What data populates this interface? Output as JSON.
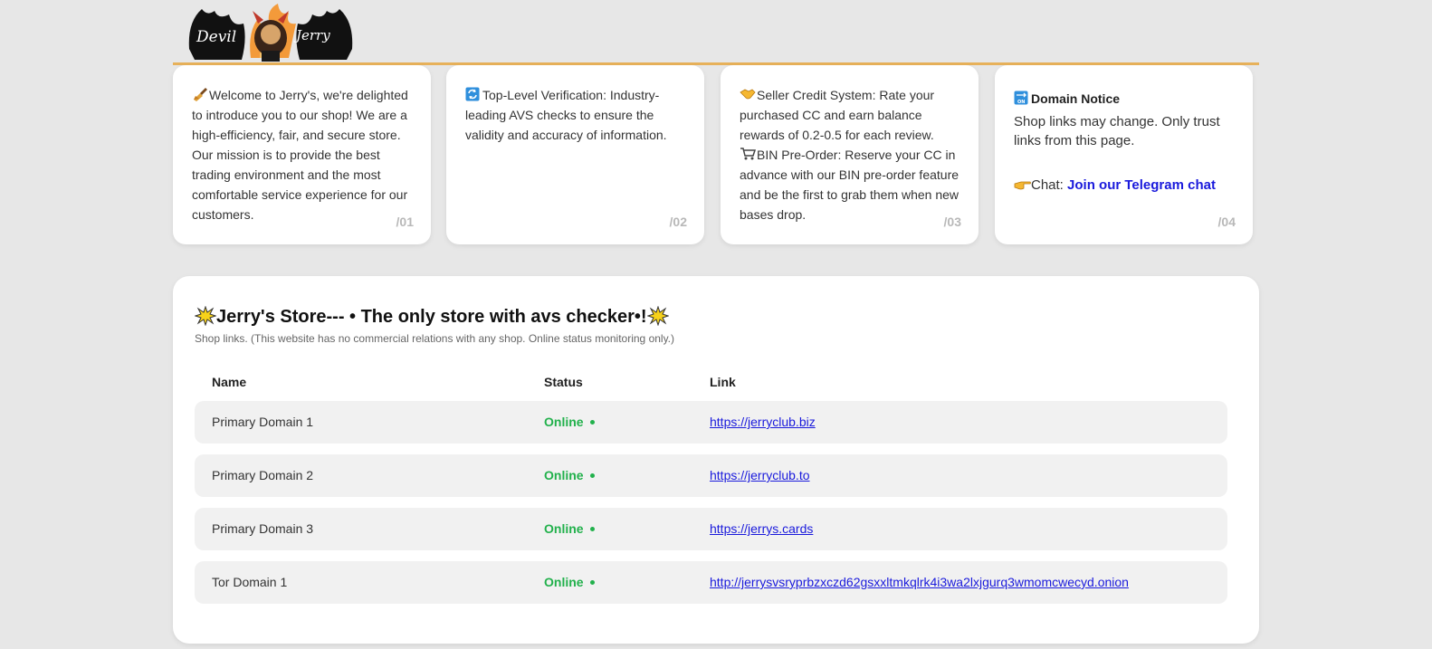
{
  "logo": {
    "text_left": "Devil",
    "text_right": "Jerry"
  },
  "cards": [
    {
      "icon": "broom-icon",
      "text": "Welcome to Jerry's, we're delighted to introduce you to our shop! We are a high-efficiency, fair, and secure store. Our mission is to provide the best trading environment and the most comfortable service experience for our customers.",
      "num": "/01"
    },
    {
      "icon": "refresh-icon",
      "text": "Top-Level Verification: Industry-leading AVS checks to ensure the validity and accuracy of information.",
      "num": "/02"
    },
    {
      "icon": "handshake-icon",
      "text": "Seller Credit System: Rate your purchased CC and earn balance rewards of 0.2-0.5 for each review.",
      "icon2": "cart-icon",
      "text2": "BIN Pre-Order: Reserve your CC in advance with our BIN pre-order feature and be the first to grab them when new bases drop.",
      "num": "/03"
    },
    {
      "icon": "on-arrow-icon",
      "title": "Domain Notice",
      "body": "Shop links may change. Only trust links from this page.",
      "chat_icon": "pointing-hand-icon",
      "chat_label": "Chat:",
      "chat_link": "Join our Telegram chat",
      "num": "/04"
    }
  ],
  "store": {
    "title": "Jerry's Store--- • The only store with avs checker•!",
    "subtitle": "Shop links. (This website has no commercial relations with any shop. Online status monitoring only.)",
    "columns": [
      "Name",
      "Status",
      "Link"
    ],
    "rows": [
      {
        "name": "Primary Domain 1",
        "status": "Online",
        "link": "https://jerryclub.biz"
      },
      {
        "name": "Primary Domain 2",
        "status": "Online",
        "link": "https://jerryclub.to"
      },
      {
        "name": "Primary Domain 3",
        "status": "Online",
        "link": "https://jerrys.cards"
      },
      {
        "name": "Tor Domain 1",
        "status": "Online",
        "link": "http://jerrysvsryprbzxczd62gsxxltmkqlrk4i3wa2lxjgurq3wmomcwecyd.onion"
      }
    ]
  },
  "colors": {
    "background": "#e7e7e7",
    "accent_bar": "#e7b15a",
    "online": "#22b14c",
    "link": "#1a1adc",
    "card_number": "#b8b8b8"
  }
}
